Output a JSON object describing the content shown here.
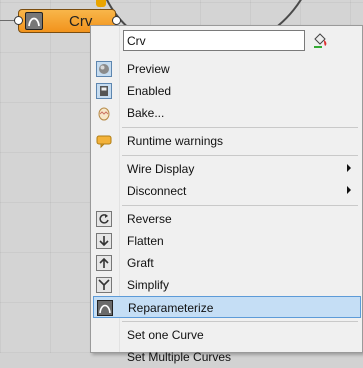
{
  "node": {
    "label": "Crv"
  },
  "menu": {
    "name_field_value": "Crv",
    "items": [
      {
        "label": "Preview",
        "icon": "preview-sphere-icon"
      },
      {
        "label": "Enabled",
        "icon": "enabled-icon"
      },
      {
        "label": "Bake...",
        "icon": "bake-egg-icon"
      },
      {
        "label": "Runtime warnings",
        "icon": "warning-balloon-icon"
      },
      {
        "label": "Wire Display",
        "icon": ""
      },
      {
        "label": "Disconnect",
        "icon": ""
      },
      {
        "label": "Reverse",
        "icon": "reverse-icon"
      },
      {
        "label": "Flatten",
        "icon": "flatten-icon"
      },
      {
        "label": "Graft",
        "icon": "graft-icon"
      },
      {
        "label": "Simplify",
        "icon": "simplify-icon"
      },
      {
        "label": "Reparameterize",
        "icon": "reparameterize-icon"
      },
      {
        "label": "Set one Curve",
        "icon": ""
      },
      {
        "label": "Set Multiple Curves",
        "icon": ""
      }
    ]
  },
  "colors": {
    "node_orange": "#f2931c",
    "selection": "#c5def5",
    "selection_border": "#5d9bd8"
  }
}
